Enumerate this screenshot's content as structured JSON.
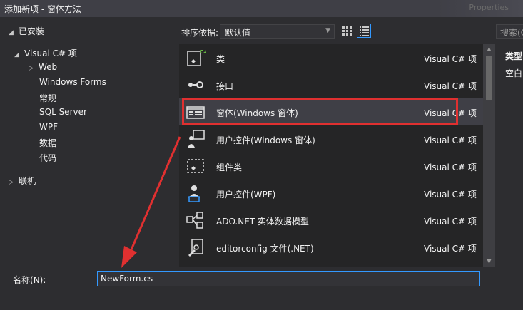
{
  "window": {
    "title": "添加新项 - 窗体方法",
    "background_hint": "Properties"
  },
  "tree": {
    "installed": "已安装",
    "language": "Visual C# 项",
    "children": [
      "Web",
      "Windows Forms",
      "常规",
      "SQL Server",
      "WPF",
      "数据",
      "代码"
    ],
    "online": "联机"
  },
  "toolbar": {
    "sort_label": "排序依据:",
    "sort_value": "默认值",
    "search_placeholder": "搜索(Ctrl+E)"
  },
  "templates": [
    {
      "name": "类",
      "lang": "Visual C# 项",
      "icon": "class-icon"
    },
    {
      "name": "接口",
      "lang": "Visual C# 项",
      "icon": "interface-icon"
    },
    {
      "name": "窗体(Windows 窗体)",
      "lang": "Visual C# 项",
      "icon": "form-icon",
      "selected": true
    },
    {
      "name": "用户控件(Windows 窗体)",
      "lang": "Visual C# 项",
      "icon": "user-control-icon"
    },
    {
      "name": "组件类",
      "lang": "Visual C# 项",
      "icon": "component-icon"
    },
    {
      "name": "用户控件(WPF)",
      "lang": "Visual C# 项",
      "icon": "wpf-user-control-icon"
    },
    {
      "name": "ADO.NET 实体数据模型",
      "lang": "Visual C# 项",
      "icon": "entity-model-icon"
    },
    {
      "name": "editorconfig 文件(.NET)",
      "lang": "Visual C# 项",
      "icon": "editorconfig-icon"
    }
  ],
  "details": {
    "type_label": "类型",
    "description": "空白"
  },
  "bottom": {
    "name_label_prefix": "名称(",
    "name_label_key": "N",
    "name_label_suffix": "):",
    "name_value": "NewForm.cs"
  },
  "colors": {
    "accent": "#3399ff",
    "highlight": "#e03030",
    "background": "#2d2d30",
    "list_background": "#252526",
    "selected": "#3f3f46"
  }
}
